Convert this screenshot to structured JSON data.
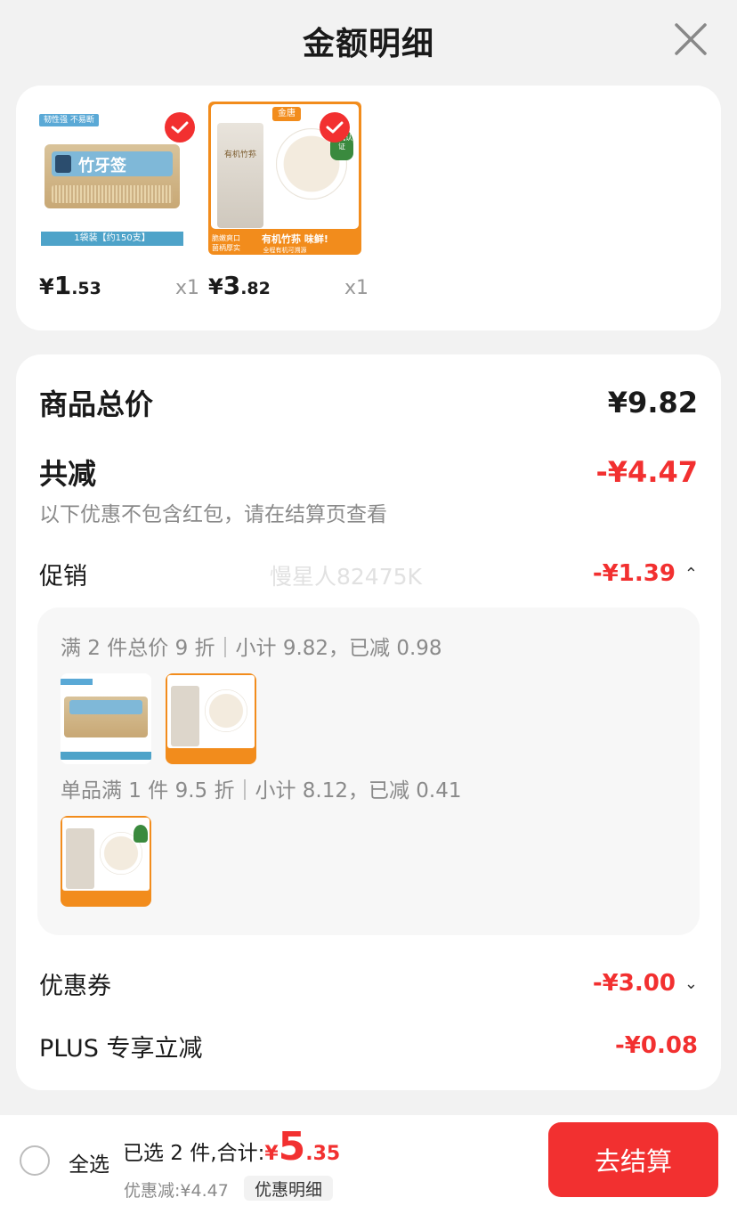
{
  "header": {
    "title": "金额明细"
  },
  "products": [
    {
      "price_currency": "¥",
      "price_int": "1",
      "price_dec": ".53",
      "qty": "x1",
      "image": {
        "tag": "韧性强 不易断",
        "brand": "竹牙签",
        "bottom_label": "1袋装【约150支】"
      }
    },
    {
      "price_currency": "¥",
      "price_int": "3",
      "price_dec": ".82",
      "qty": "x1",
      "image": {
        "brand_tag": "金唐",
        "jar_label": "有机竹荪",
        "badge": "有机认证",
        "slogan": "有机竹荪 味鲜!",
        "feature1": "脆嫩爽口",
        "feature2": "菌柄厚实",
        "footnote": "全程有机可溯源"
      }
    }
  ],
  "summary": {
    "total_label": "商品总价",
    "total_value": "¥9.82",
    "reduce_label": "共减",
    "reduce_value": "-¥4.47",
    "note": "以下优惠不包含红包，请在结算页查看",
    "promo_label": "促销",
    "promo_value": "-¥1.39",
    "watermark": "慢星人82475K",
    "promo_line1": "满 2 件总价 9 折｜小计 9.82，已减 0.98",
    "promo_line2": "单品满 1 件 9.5 折｜小计 8.12，已减 0.41",
    "coupon_label": "优惠券",
    "coupon_value": "-¥3.00",
    "plus_label": "PLUS 专享立减",
    "plus_value": "-¥0.08"
  },
  "bottom": {
    "select_all": "全选",
    "selected_text": "已选 2 件,合计:",
    "total_currency": "¥",
    "total_int": "5",
    "total_dec": ".35",
    "discount_text": "优惠减:¥4.47",
    "detail_button": "优惠明细",
    "checkout_button": "去结算"
  },
  "colors": {
    "accent": "#f23030",
    "muted": "#8a8a8a",
    "background": "#f2f2f2"
  }
}
